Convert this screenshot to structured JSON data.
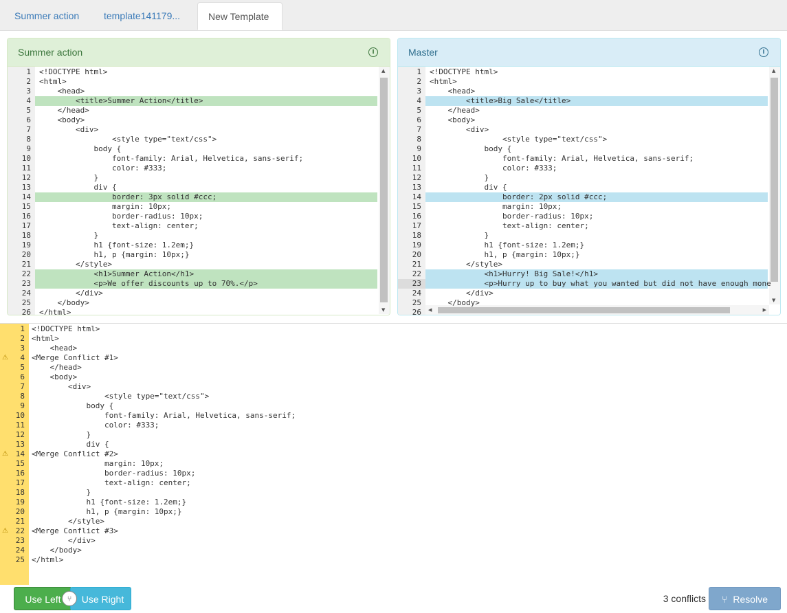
{
  "tabs": [
    {
      "label": "Summer action",
      "active": false
    },
    {
      "label": "template141179...",
      "active": false
    },
    {
      "label": "New Template",
      "active": true
    }
  ],
  "left_panel": {
    "title": "Summer action",
    "lines": [
      {
        "n": 1,
        "text": "<!DOCTYPE html>",
        "hl": false
      },
      {
        "n": 2,
        "text": "<html>",
        "hl": false
      },
      {
        "n": 3,
        "text": "    <head>",
        "hl": false
      },
      {
        "n": 4,
        "text": "        <title>Summer Action</title>",
        "hl": true
      },
      {
        "n": 5,
        "text": "    </head>",
        "hl": false
      },
      {
        "n": 6,
        "text": "    <body>",
        "hl": false
      },
      {
        "n": 7,
        "text": "        <div>",
        "hl": false
      },
      {
        "n": 8,
        "text": "                <style type=\"text/css\">",
        "hl": false
      },
      {
        "n": 9,
        "text": "            body {",
        "hl": false
      },
      {
        "n": 10,
        "text": "                font-family: Arial, Helvetica, sans-serif;",
        "hl": false
      },
      {
        "n": 11,
        "text": "                color: #333;",
        "hl": false
      },
      {
        "n": 12,
        "text": "            }",
        "hl": false
      },
      {
        "n": 13,
        "text": "            div {",
        "hl": false
      },
      {
        "n": 14,
        "text": "                border: 3px solid #ccc;",
        "hl": true
      },
      {
        "n": 15,
        "text": "                margin: 10px;",
        "hl": false
      },
      {
        "n": 16,
        "text": "                border-radius: 10px;",
        "hl": false
      },
      {
        "n": 17,
        "text": "                text-align: center;",
        "hl": false
      },
      {
        "n": 18,
        "text": "            }",
        "hl": false
      },
      {
        "n": 19,
        "text": "            h1 {font-size: 1.2em;}",
        "hl": false
      },
      {
        "n": 20,
        "text": "            h1, p {margin: 10px;}",
        "hl": false
      },
      {
        "n": 21,
        "text": "        </style>",
        "hl": false
      },
      {
        "n": 22,
        "text": "            <h1>Summer Action</h1>",
        "hl": true
      },
      {
        "n": 23,
        "text": "            <p>We offer discounts up to 70%.</p>",
        "hl": true
      },
      {
        "n": 24,
        "text": "        </div>",
        "hl": false
      },
      {
        "n": 25,
        "text": "    </body>",
        "hl": false
      },
      {
        "n": 26,
        "text": "</html>",
        "hl": false
      }
    ]
  },
  "right_panel": {
    "title": "Master",
    "lines": [
      {
        "n": 1,
        "text": "<!DOCTYPE html>",
        "hl": false
      },
      {
        "n": 2,
        "text": "<html>",
        "hl": false
      },
      {
        "n": 3,
        "text": "    <head>",
        "hl": false
      },
      {
        "n": 4,
        "text": "        <title>Big Sale</title>",
        "hl": true
      },
      {
        "n": 5,
        "text": "    </head>",
        "hl": false
      },
      {
        "n": 6,
        "text": "    <body>",
        "hl": false
      },
      {
        "n": 7,
        "text": "        <div>",
        "hl": false
      },
      {
        "n": 8,
        "text": "                <style type=\"text/css\">",
        "hl": false
      },
      {
        "n": 9,
        "text": "            body {",
        "hl": false
      },
      {
        "n": 10,
        "text": "                font-family: Arial, Helvetica, sans-serif;",
        "hl": false
      },
      {
        "n": 11,
        "text": "                color: #333;",
        "hl": false
      },
      {
        "n": 12,
        "text": "            }",
        "hl": false
      },
      {
        "n": 13,
        "text": "            div {",
        "hl": false
      },
      {
        "n": 14,
        "text": "                border: 2px solid #ccc;",
        "hl": true
      },
      {
        "n": 15,
        "text": "                margin: 10px;",
        "hl": false
      },
      {
        "n": 16,
        "text": "                border-radius: 10px;",
        "hl": false
      },
      {
        "n": 17,
        "text": "                text-align: center;",
        "hl": false
      },
      {
        "n": 18,
        "text": "            }",
        "hl": false
      },
      {
        "n": 19,
        "text": "            h1 {font-size: 1.2em;}",
        "hl": false
      },
      {
        "n": 20,
        "text": "            h1, p {margin: 10px;}",
        "hl": false
      },
      {
        "n": 21,
        "text": "        </style>",
        "hl": false
      },
      {
        "n": 22,
        "text": "            <h1>Hurry! Big Sale!</h1>",
        "hl": true
      },
      {
        "n": 23,
        "text": "            <p>Hurry up to buy what you wanted but did not have enough mone",
        "hl": true
      },
      {
        "n": 24,
        "text": "        </div>",
        "hl": false
      },
      {
        "n": 25,
        "text": "    </body>",
        "hl": false
      },
      {
        "n": 26,
        "text": "",
        "hl": false
      }
    ]
  },
  "merged": {
    "lines": [
      {
        "n": 1,
        "text": "<!DOCTYPE html>",
        "warn": false
      },
      {
        "n": 2,
        "text": "<html>",
        "warn": false
      },
      {
        "n": 3,
        "text": "    <head>",
        "warn": false
      },
      {
        "n": 4,
        "text": "<Merge Conflict #1>",
        "warn": true
      },
      {
        "n": 5,
        "text": "    </head>",
        "warn": false
      },
      {
        "n": 6,
        "text": "    <body>",
        "warn": false
      },
      {
        "n": 7,
        "text": "        <div>",
        "warn": false
      },
      {
        "n": 8,
        "text": "                <style type=\"text/css\">",
        "warn": false
      },
      {
        "n": 9,
        "text": "            body {",
        "warn": false
      },
      {
        "n": 10,
        "text": "                font-family: Arial, Helvetica, sans-serif;",
        "warn": false
      },
      {
        "n": 11,
        "text": "                color: #333;",
        "warn": false
      },
      {
        "n": 12,
        "text": "            }",
        "warn": false
      },
      {
        "n": 13,
        "text": "            div {",
        "warn": false
      },
      {
        "n": 14,
        "text": "<Merge Conflict #2>",
        "warn": true
      },
      {
        "n": 15,
        "text": "                margin: 10px;",
        "warn": false
      },
      {
        "n": 16,
        "text": "                border-radius: 10px;",
        "warn": false
      },
      {
        "n": 17,
        "text": "                text-align: center;",
        "warn": false
      },
      {
        "n": 18,
        "text": "            }",
        "warn": false
      },
      {
        "n": 19,
        "text": "            h1 {font-size: 1.2em;}",
        "warn": false
      },
      {
        "n": 20,
        "text": "            h1, p {margin: 10px;}",
        "warn": false
      },
      {
        "n": 21,
        "text": "        </style>",
        "warn": false
      },
      {
        "n": 22,
        "text": "<Merge Conflict #3>",
        "warn": true
      },
      {
        "n": 23,
        "text": "        </div>",
        "warn": false
      },
      {
        "n": 24,
        "text": "    </body>",
        "warn": false
      },
      {
        "n": 25,
        "text": "</html>",
        "warn": false
      }
    ]
  },
  "footer": {
    "use_left": "Use Left",
    "use_right": "Use Right",
    "conflicts": "3 conflicts",
    "resolve": "Resolve"
  },
  "icons": {
    "info": "info-icon",
    "warning": "warning-icon",
    "branch": "branch-icon"
  },
  "colors": {
    "left_highlight": "#bfe3bf",
    "right_highlight": "#bde3f1",
    "conflict_gutter": "#ffdf6e",
    "use_left": "#4cae4c",
    "use_right": "#46b8da",
    "resolve": "#7fa7cc"
  }
}
